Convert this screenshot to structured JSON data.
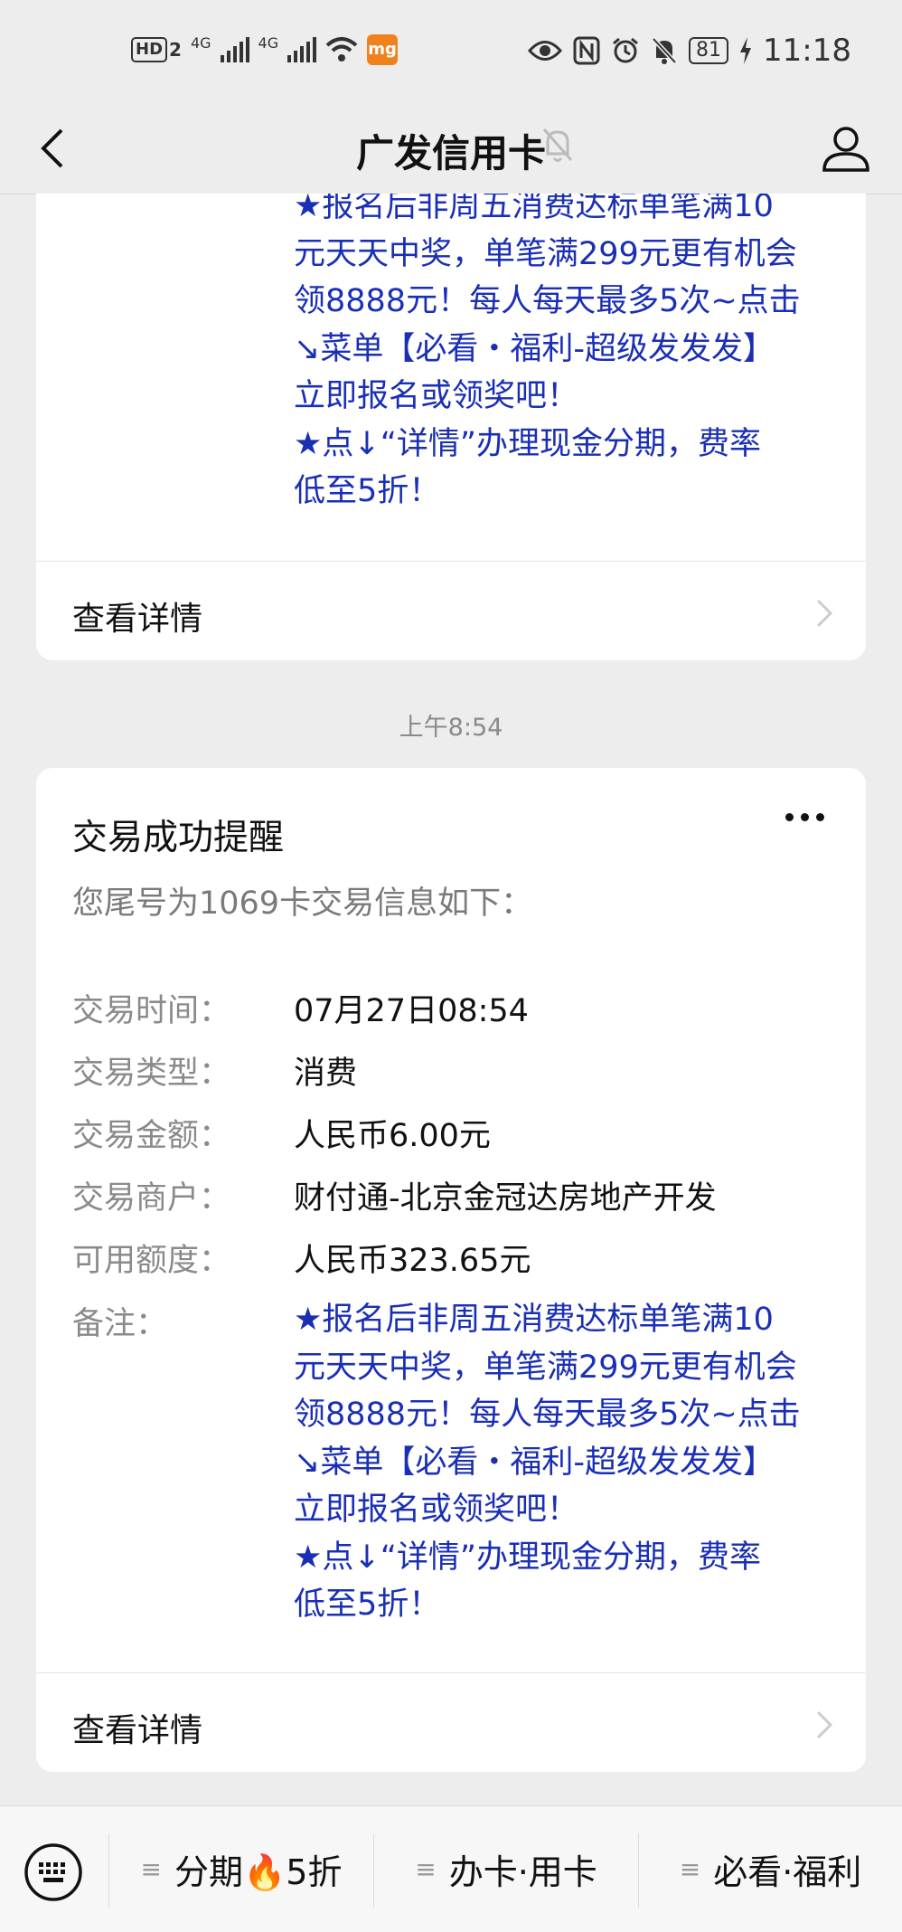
{
  "status_bar": {
    "hd": "HD",
    "sim2": "2",
    "net1": "4G",
    "net2": "4G",
    "app_badge": "mg",
    "battery": "81",
    "time": "11:18"
  },
  "header": {
    "title": "广发信用卡"
  },
  "card1": {
    "promo_text": "★报名后非周五消费达标单笔满10\n元天天中奖，单笔满299元更有机会\n领8888元！每人每天最多5次~点击\n↘菜单【必看・福利-超级发发发】\n立即报名或领奖吧！\n★点↓“详情”办理现金分期，费率\n低至5折！",
    "detail_label": "查看详情"
  },
  "timestamp": "上午8:54",
  "card2": {
    "title": "交易成功提醒",
    "subtitle": "您尾号为1069卡交易信息如下：",
    "fields": [
      {
        "label": "交易时间：",
        "value": "07月27日08:54"
      },
      {
        "label": "交易类型：",
        "value": "消费"
      },
      {
        "label": "交易金额：",
        "value": "人民币6.00元"
      },
      {
        "label": "交易商户：",
        "value": "财付通-北京金冠达房地产开发"
      },
      {
        "label": "可用额度：",
        "value": "人民币323.65元"
      },
      {
        "label": "备注："
      }
    ],
    "remark": "★报名后非周五消费达标单笔满10\n元天天中奖，单笔满299元更有机会\n领8888元！每人每天最多5次~点击\n↘菜单【必看・福利-超级发发发】\n立即报名或领奖吧！\n★点↓“详情”办理现金分期，费率\n低至5折！",
    "detail_label": "查看详情"
  },
  "bottom_menu": {
    "items": [
      {
        "label": "分期🔥5折"
      },
      {
        "label": "办卡·用卡"
      },
      {
        "label": "必看·福利"
      }
    ]
  }
}
